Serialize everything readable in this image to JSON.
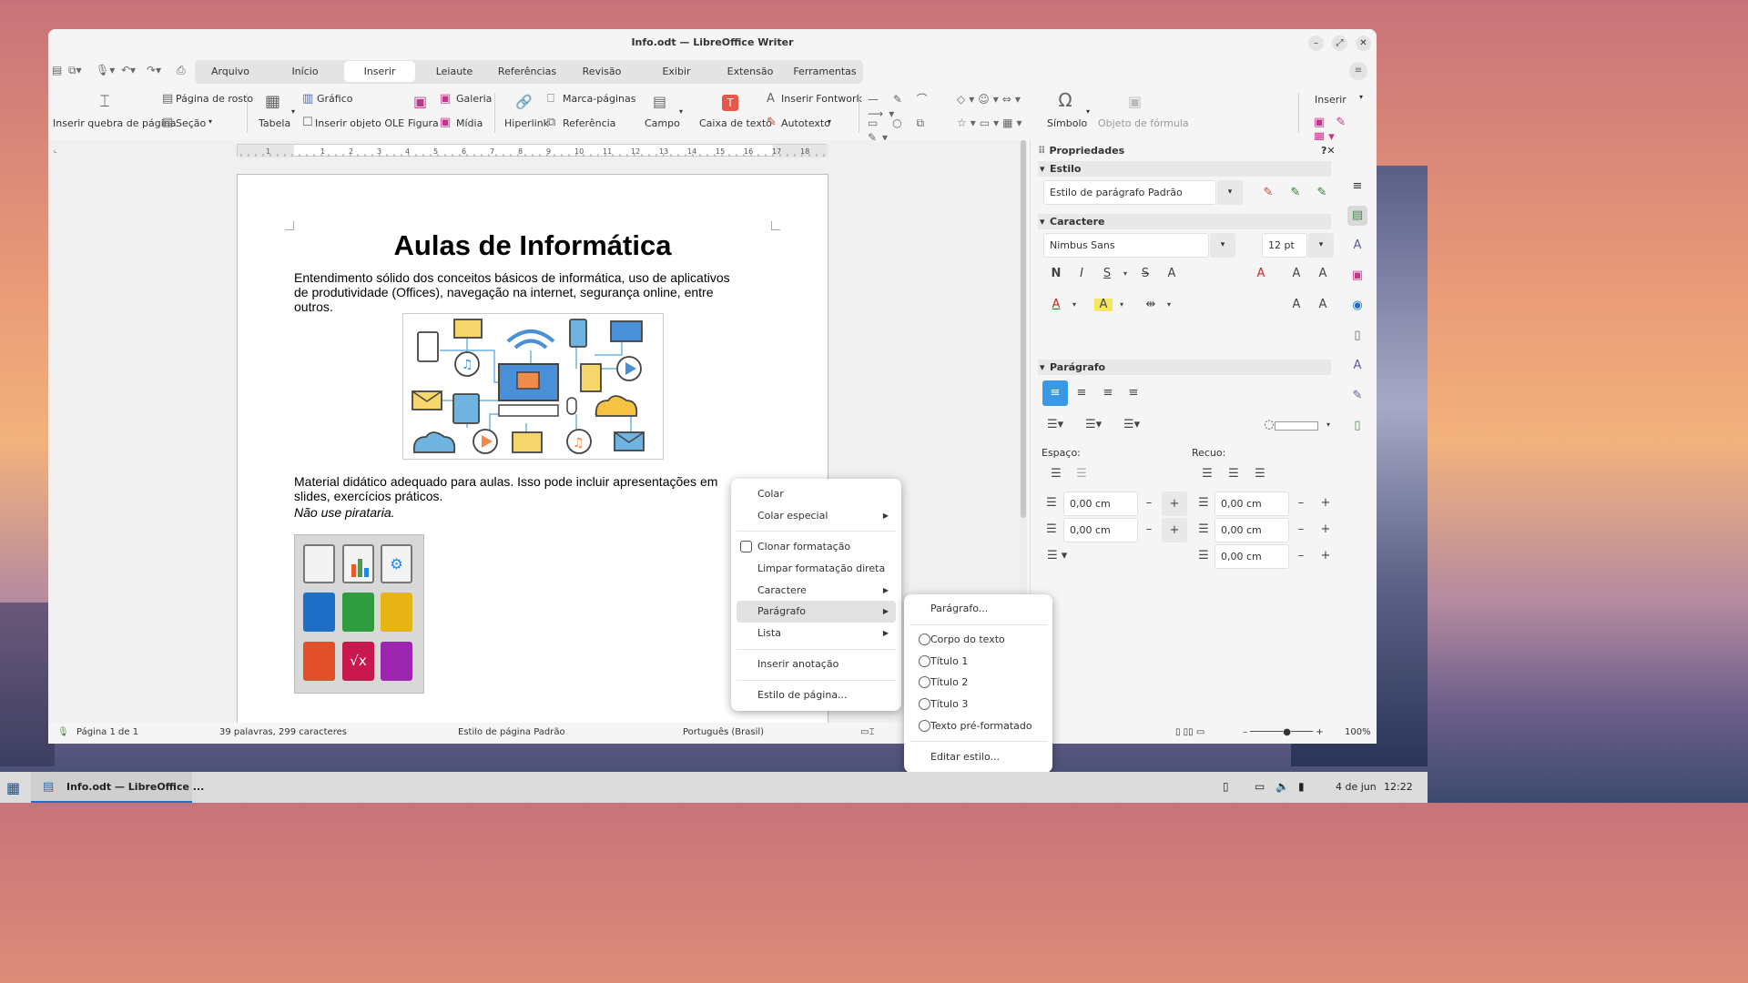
{
  "window": {
    "title": "Info.odt — LibreOffice Writer"
  },
  "tabs": [
    "Arquivo",
    "Início",
    "Inserir",
    "Leiaute",
    "Referências",
    "Revisão",
    "Exibir",
    "Extensão",
    "Ferramentas"
  ],
  "ribbon": {
    "page_break": "Inserir quebra de página",
    "cover_page": "Página de rosto",
    "section": "Seção",
    "table": "Tabela",
    "chart": "Gráfico",
    "ole": "Inserir objeto OLE",
    "figure": "Figura",
    "gallery": "Galeria",
    "media": "Mídia",
    "hyperlink": "Hiperlink",
    "bookmark": "Marca-páginas",
    "reference": "Referência",
    "field": "Campo",
    "textbox": "Caixa de texto",
    "fontwork": "Inserir Fontwork",
    "autotext": "Autotexto",
    "symbol": "Símbolo",
    "formula": "Objeto de fórmula",
    "insert": "Inserir"
  },
  "ruler": [
    "1",
    "1",
    "2",
    "3",
    "4",
    "5",
    "6",
    "7",
    "8",
    "9",
    "10",
    "11",
    "12",
    "13",
    "14",
    "15",
    "16",
    "17",
    "18"
  ],
  "document": {
    "title": "Aulas de Informática",
    "para1": "Entendimento sólido dos conceitos básicos de informática, uso de aplicativos de produtividade (Offices), navegação na internet, segurança online, entre outros.",
    "para2": "Material didático adequado para aulas. Isso pode incluir apresentações em slides, exercícios práticos.",
    "para3": "Não use pirataria."
  },
  "sidebar": {
    "title": "Propriedades",
    "style_hdr": "Estilo",
    "para_style": "Estilo de parágrafo Padrão",
    "char_hdr": "Caractere",
    "font": "Nimbus Sans",
    "size": "12 pt",
    "para_hdr": "Parágrafo",
    "spacing": "Espaço:",
    "indent": "Recuo:",
    "v1": "0,00 cm",
    "v2": "0,00 cm",
    "v3": "0,00 cm",
    "v4": "0,00 cm",
    "v5": "0,00 cm"
  },
  "status": {
    "page": "Página 1 de 1",
    "words": "39 palavras, 299 caracteres",
    "page_style": "Estilo de página Padrão",
    "lang": "Português (Brasil)",
    "zoom": "100%"
  },
  "context_menu": {
    "paste": "Colar",
    "paste_special": "Colar especial",
    "clone": "Clonar formatação",
    "clear": "Limpar formatação direta",
    "character": "Caractere",
    "paragraph": "Parágrafo",
    "list": "Lista",
    "annotation": "Inserir anotação",
    "page_style": "Estilo de página..."
  },
  "submenu": {
    "paragraph": "Parágrafo...",
    "body": "Corpo do texto",
    "h1": "Título 1",
    "h2": "Título 2",
    "h3": "Título 3",
    "pre": "Texto pré-formatado",
    "edit": "Editar estilo..."
  },
  "taskbar": {
    "app": "Info.odt — LibreOffice ...",
    "date": "4 de jun",
    "time": "12:22"
  }
}
